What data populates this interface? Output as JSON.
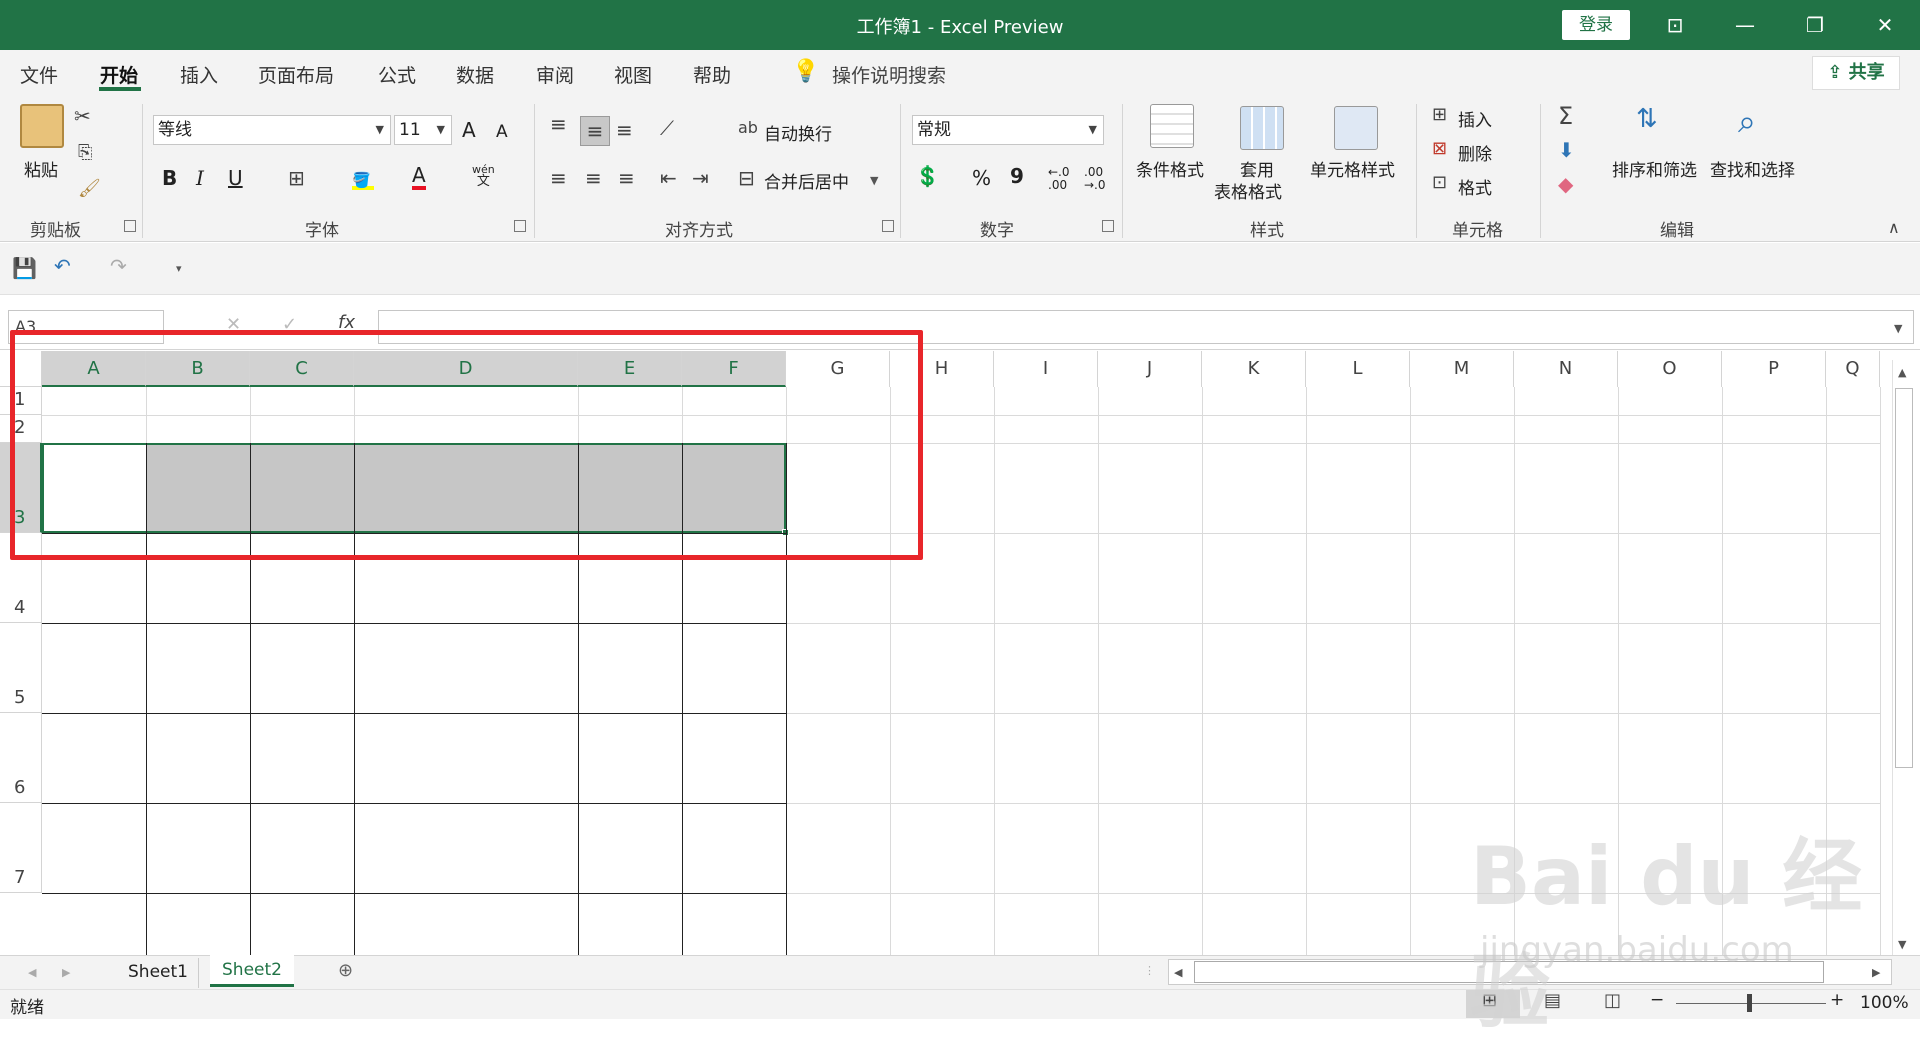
{
  "titlebar": {
    "title": "工作簿1  -  Excel Preview",
    "login": "登录"
  },
  "tabs": [
    "文件",
    "开始",
    "插入",
    "页面布局",
    "公式",
    "数据",
    "审阅",
    "视图",
    "帮助"
  ],
  "tell_me": "操作说明搜索",
  "share": "共享",
  "clipboard": {
    "paste": "粘贴",
    "group": "剪贴板"
  },
  "font": {
    "name": "等线",
    "size": "11",
    "bold": "B",
    "italic": "I",
    "underline": "U",
    "grow": "A",
    "shrink": "A",
    "wen": "wén",
    "wen2": "文",
    "font_color": "A",
    "group": "字体"
  },
  "align": {
    "wrap": "自动换行",
    "merge": "合并后居中",
    "group": "对齐方式"
  },
  "number": {
    "format": "常规",
    "percent": "%",
    "comma": "9",
    "inc": "←.0\n.00",
    "dec": ".00\n→.0",
    "group": "数字"
  },
  "styles": {
    "conditional": "条件格式",
    "table1": "套用",
    "table2": "表格格式",
    "cell": "单元格样式",
    "group": "样式"
  },
  "cells": {
    "insert": "插入",
    "delete": "删除",
    "format": "格式",
    "group": "单元格"
  },
  "editing": {
    "sum": "Σ",
    "sort": "排序和筛选",
    "find": "查找和选择",
    "group": "编辑"
  },
  "formula": {
    "namebox": "A3",
    "fx": "fx",
    "cancel": "✕",
    "enter": "✓"
  },
  "columns": [
    "A",
    "B",
    "C",
    "D",
    "E",
    "F",
    "G",
    "H",
    "I",
    "J",
    "K",
    "L",
    "M",
    "N",
    "O",
    "P",
    "Q"
  ],
  "rows": [
    "1",
    "2",
    "3",
    "4",
    "5",
    "6",
    "7"
  ],
  "sheets": [
    "Sheet1",
    "Sheet2"
  ],
  "status": {
    "ready": "就绪",
    "zoom": "100%"
  },
  "watermark": {
    "brand": "Bai du 经验",
    "url": "jingyan.baidu.com"
  },
  "colors": {
    "accent": "#217346",
    "highlight": "#e8262a",
    "selection": "#c6c6c6"
  }
}
